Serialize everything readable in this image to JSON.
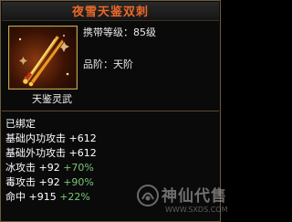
{
  "item": {
    "name": "夜雪天鉴双刺",
    "required_level": "携带等级：85级",
    "grade": "品阶：天阶",
    "subtitle": "天鉴灵武",
    "icon": "twin-dagger-icon"
  },
  "stats": {
    "bound": "已绑定",
    "lines": [
      {
        "base": "基础内功攻击 +612",
        "bonus": ""
      },
      {
        "base": "基础外功攻击 +612",
        "bonus": ""
      },
      {
        "base": "冰攻击 +92 ",
        "bonus": "+70%"
      },
      {
        "base": "毒攻击 +92 ",
        "bonus": "+90%"
      },
      {
        "base": "命中 +915 ",
        "bonus": "+22%"
      }
    ]
  },
  "watermark": {
    "text": "神仙代售",
    "url": "WWW.SXDS.COM"
  },
  "colors": {
    "title": "#e8682a",
    "border": "#c8a050",
    "bonus": "#78c878"
  }
}
